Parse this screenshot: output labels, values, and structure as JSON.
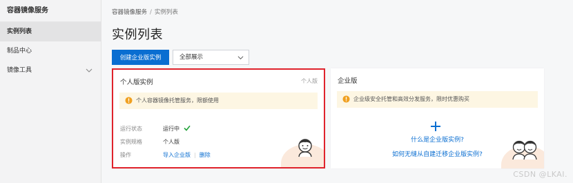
{
  "sidebar": {
    "title": "容器镜像服务",
    "items": [
      {
        "label": "实例列表",
        "active": true
      },
      {
        "label": "制品中心",
        "active": false
      },
      {
        "label": "镜像工具",
        "active": false,
        "expandable": true
      }
    ]
  },
  "breadcrumb": {
    "root": "容器镜像服务",
    "separator": "/",
    "current": "实例列表"
  },
  "page_title": "实例列表",
  "toolbar": {
    "create_label": "创建企业版实例",
    "filter_value": "全部展示"
  },
  "personal_card": {
    "title": "个人版实例",
    "tag": "个人版",
    "notice": "个人容器镜像托管服务，限额使用",
    "status_key": "运行状态",
    "status_value": "运行中",
    "spec_key": "实例规格",
    "spec_value": "个人版",
    "ops_key": "操作",
    "ops_import": "导入企业版",
    "ops_delete": "删除"
  },
  "enterprise_card": {
    "title": "企业版",
    "notice": "企业级安全托管和高效分发服务，限时优惠购买",
    "link_what": "什么是企业版实例?",
    "link_migrate": "如何无缝从自建迁移企业版实例?"
  },
  "watermark": "CSDN @LKAI.",
  "colors": {
    "primary": "#0a6ed1",
    "highlight_border": "#e0222b",
    "notice_bg": "#fdf6e3",
    "warn": "#f0a020",
    "success": "#22a33a"
  },
  "icons": [
    "chevron-down-icon",
    "caret-down-icon",
    "warning-icon",
    "check-icon",
    "plus-icon",
    "avatar-icon"
  ]
}
